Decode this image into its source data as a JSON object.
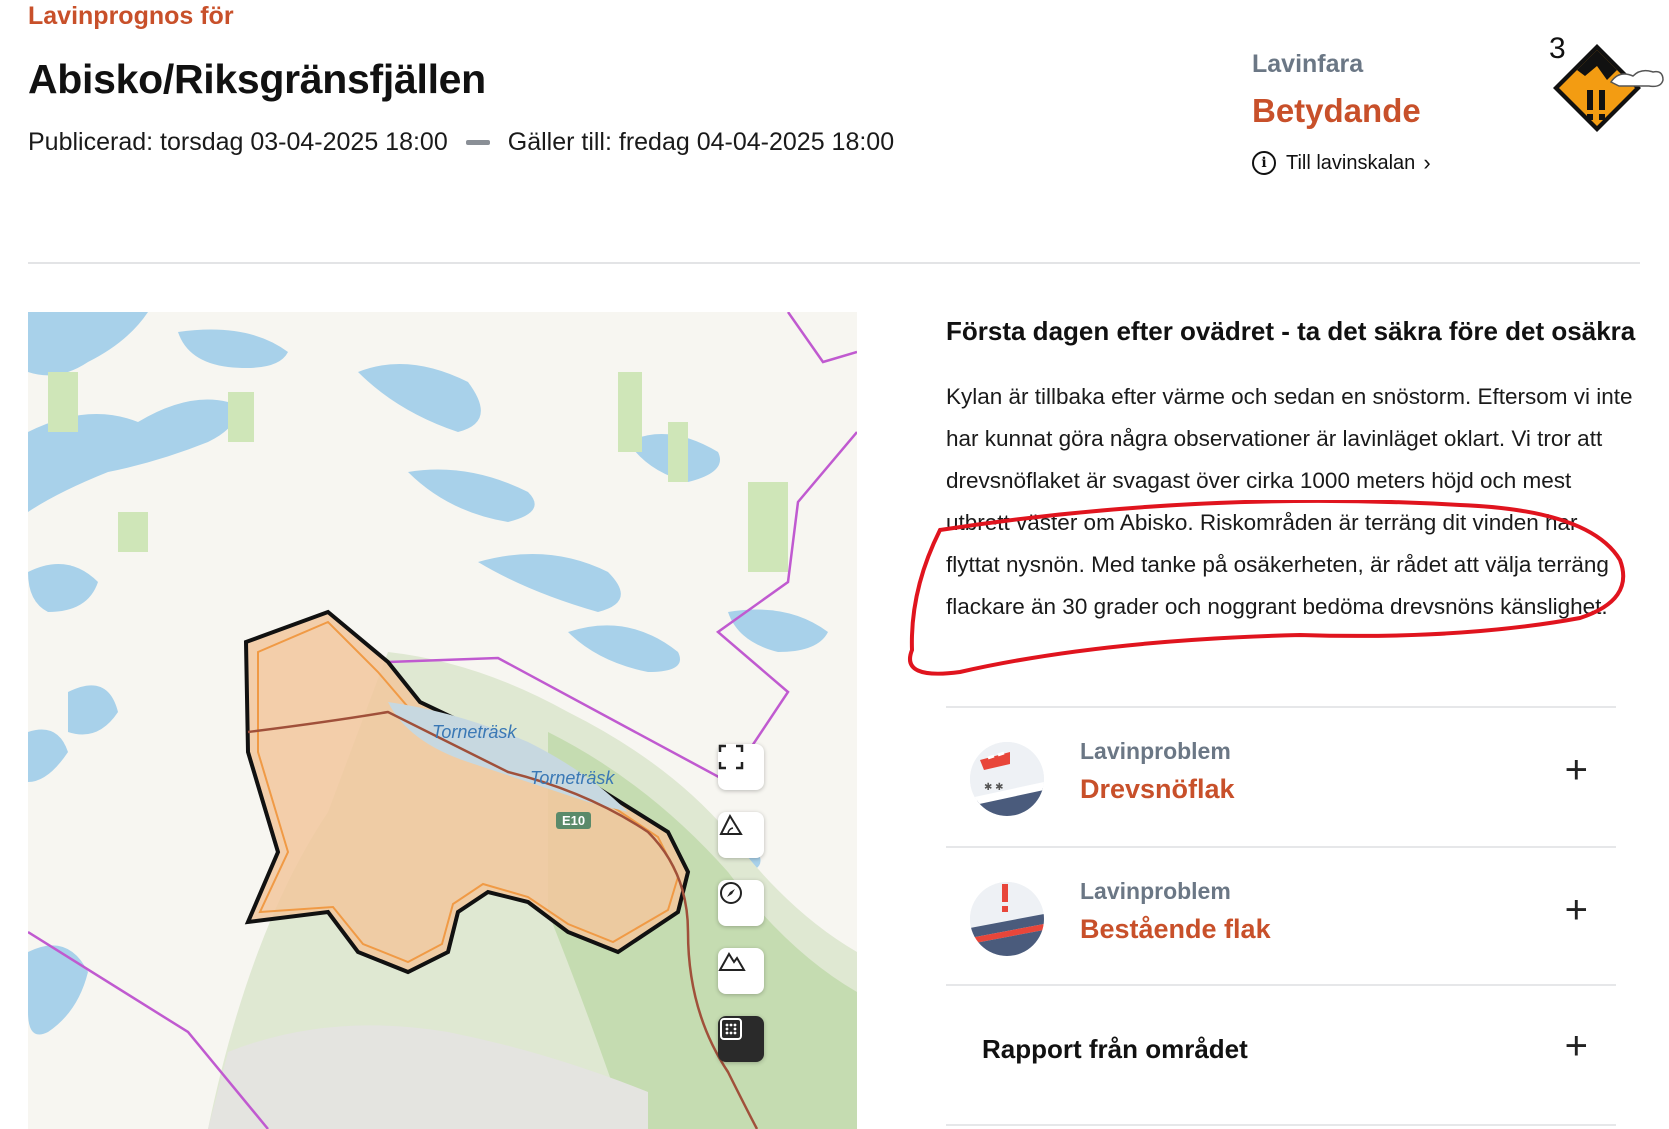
{
  "header": {
    "pre_title": "Lavinprognos för",
    "title": "Abisko/Riksgränsfjällen",
    "published": "Publicerad: torsdag 03-04-2025 18:00",
    "valid_until": "Gäller till: fredag 04-04-2025 18:00"
  },
  "danger": {
    "label": "Lavinfara",
    "level_name": "Betydande",
    "level_number": "3",
    "scale_link": "Till lavinskalan",
    "color": "#f39c12"
  },
  "map": {
    "labels": [
      "Torneträsk",
      "Torneträsk"
    ],
    "road": "E10",
    "controls": [
      "fullscreen-icon",
      "slope-icon",
      "compass-icon",
      "terrain-icon",
      "grid-icon"
    ]
  },
  "forecast": {
    "headline": "Första dagen efter ovädret - ta det säkra före det osäkra",
    "body": "Kylan är tillbaka efter värme och sedan en snöstorm. Eftersom vi inte har kunnat göra några observationer är lavinläget oklart. Vi tror att drevsnöflaket är svagast över cirka 1000 meters höjd och mest utbrett väster om Abisko. Riskområden är terräng dit vinden har flyttat nysnön. Med tanke på osäkerheten, är rådet att välja terräng flackare än 30 grader och noggrant bedöma drevsnöns känslighet."
  },
  "problems": [
    {
      "kicker": "Lavinproblem",
      "name": "Drevsnöflak",
      "icon": "wind-slab-icon"
    },
    {
      "kicker": "Lavinproblem",
      "name": "Bestående flak",
      "icon": "persistent-slab-icon"
    }
  ],
  "report": {
    "label": "Rapport från området"
  },
  "colors": {
    "accent": "#c8502a",
    "muted": "#6b7785",
    "annotation": "#e0141e"
  }
}
